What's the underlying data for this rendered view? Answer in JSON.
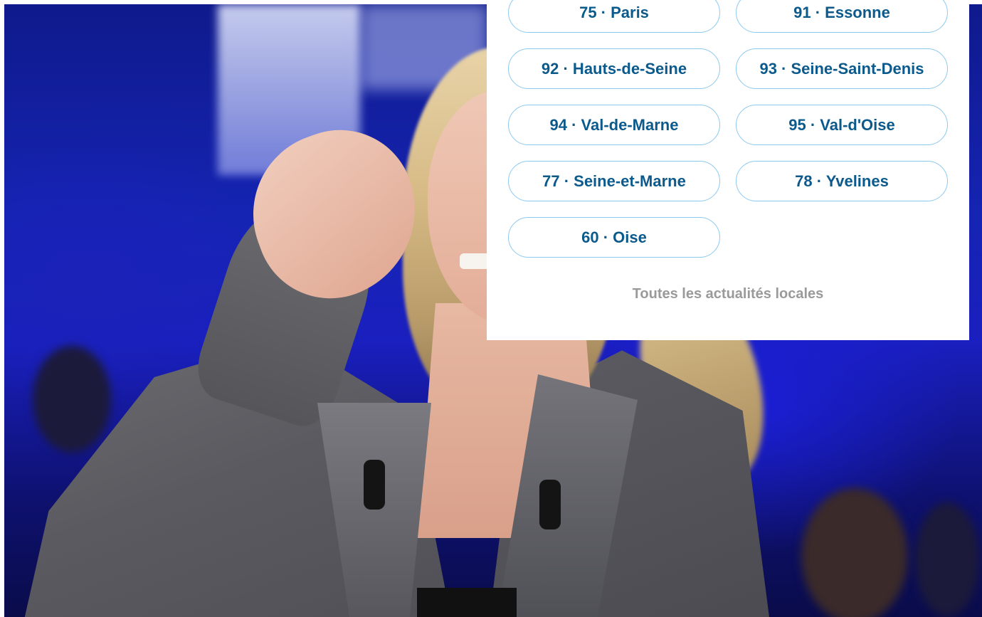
{
  "dropdown": {
    "departments": [
      {
        "label": "75 · Paris"
      },
      {
        "label": "91 · Essonne"
      },
      {
        "label": "92 · Hauts-de-Seine"
      },
      {
        "label": "93 · Seine-Saint-Denis"
      },
      {
        "label": "94 · Val-de-Marne"
      },
      {
        "label": "95 · Val-d'Oise"
      },
      {
        "label": "77 · Seine-et-Marne"
      },
      {
        "label": "78 · Yvelines"
      },
      {
        "label": "60 · Oise"
      }
    ],
    "all_news_label": "Toutes les actualités locales"
  },
  "colors": {
    "button_text": "#0c5a8c",
    "button_border": "#8ccaf0",
    "link_muted": "#9a9a9a",
    "panel_bg": "#ffffff"
  }
}
